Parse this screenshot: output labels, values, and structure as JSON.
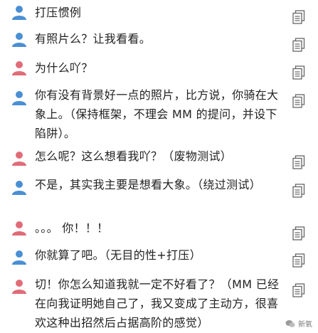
{
  "colors": {
    "male_avatar": "#4a8fd3",
    "female_avatar": "#e06c78",
    "copy_icon": "#666666",
    "text": "#222222"
  },
  "messages": [
    {
      "speaker": "male",
      "avatar_icon": "person-blue-icon",
      "text": "打压惯例"
    },
    {
      "speaker": "male",
      "avatar_icon": "person-blue-icon",
      "text": "有照片么？让我看看。"
    },
    {
      "speaker": "female",
      "avatar_icon": "person-pink-icon",
      "text": "为什么吖？"
    },
    {
      "speaker": "male",
      "avatar_icon": "person-blue-icon",
      "text": "你有没有背景好一点的照片，比方说，你骑在大象上。（保持框架，不理会 MM 的提问，并设下陷阱）。"
    },
    {
      "speaker": "female",
      "avatar_icon": "person-pink-icon",
      "text": "怎么呢？这么想看我吖？（废物测试）"
    },
    {
      "speaker": "male",
      "avatar_icon": "person-blue-icon",
      "text": "不是，其实我主要是想看大象。（绕过测试）"
    },
    {
      "speaker": "female",
      "avatar_icon": "person-pink-icon",
      "text": "。。。 你！！！"
    },
    {
      "speaker": "male",
      "avatar_icon": "person-blue-icon",
      "text": "你就算了吧。（无目的性+打压）"
    },
    {
      "speaker": "female",
      "avatar_icon": "person-pink-icon",
      "text": "切！你怎么知道我就一定不好看了？（MM 已经在向我证明她自己了，我又变成了主动方，很喜欢这种出招然后占据高阶的感觉）"
    }
  ],
  "watermark": {
    "icon": "wechat-icon",
    "text": "新氧"
  }
}
